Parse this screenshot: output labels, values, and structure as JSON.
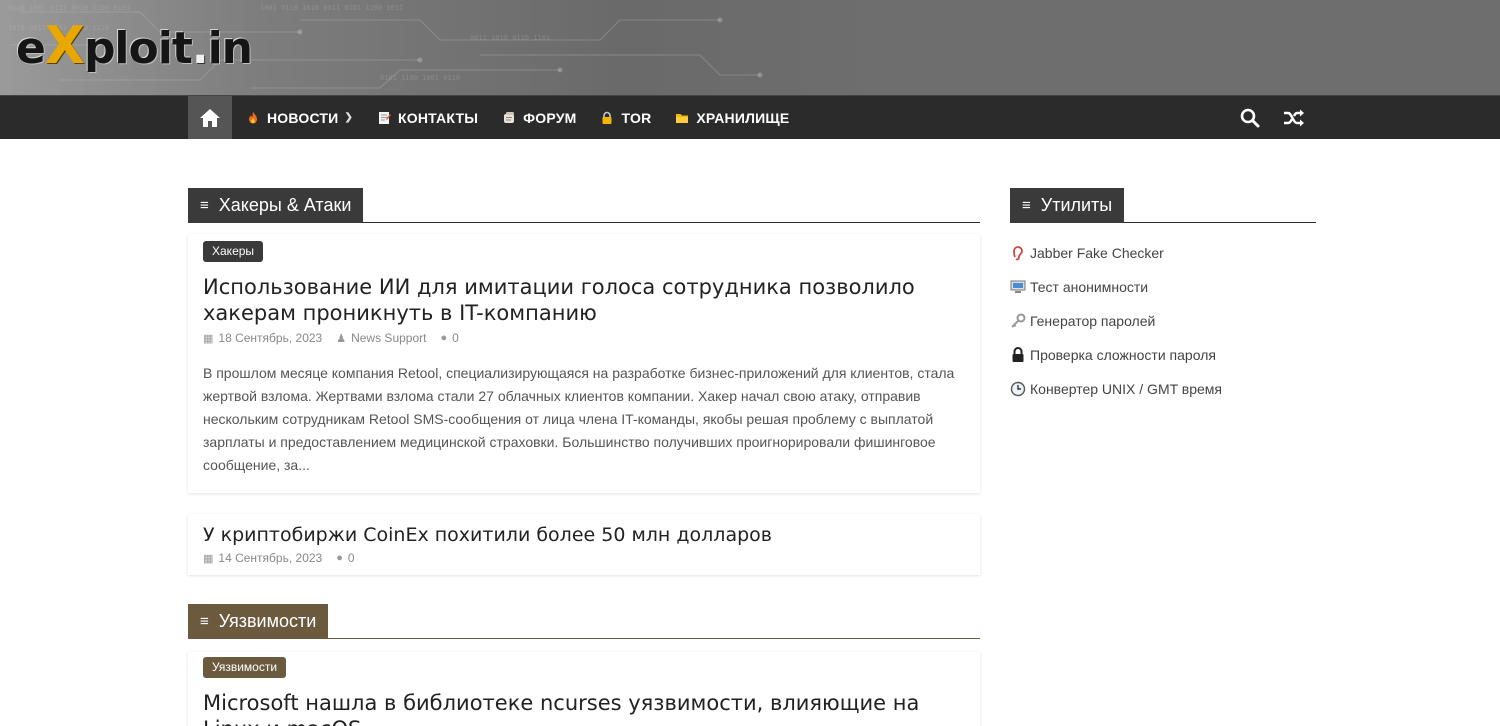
{
  "header": {
    "logo": {
      "part1": "e",
      "x": "X",
      "part2": "ploit",
      "dot": ".",
      "part3": "in"
    }
  },
  "nav": {
    "home_icon": "home-icon",
    "items": [
      {
        "label": "НОВОСТИ",
        "icon": "fire-icon",
        "has_dropdown": true
      },
      {
        "label": "КОНТАКТЫ",
        "icon": "memo-icon",
        "has_dropdown": false
      },
      {
        "label": "ФОРУМ",
        "icon": "scroll-icon",
        "has_dropdown": false
      },
      {
        "label": "TOR",
        "icon": "lock-icon",
        "has_dropdown": false
      },
      {
        "label": "ХРАНИЛИЩЕ",
        "icon": "folder-icon",
        "has_dropdown": false
      }
    ],
    "search_icon": "search-icon",
    "random_icon": "shuffle-icon"
  },
  "sections": {
    "hackers": {
      "title": "Хакеры & Атаки"
    },
    "utilities": {
      "title": "Утилиты"
    },
    "vulns": {
      "title": "Уязвимости"
    }
  },
  "posts": {
    "featured": {
      "category": "Хакеры",
      "title": "Использование ИИ для имитации голоса сотрудника позволило хакерам проникнуть в IT-компанию",
      "date": "18 Сентябрь, 2023",
      "author": "News Support",
      "comments": "0",
      "excerpt": "В прошлом месяце компания Retool, специализирующаяся на разработке бизнес-приложений для клиентов, стала жертвой взлома. Жертвами взлома стали 27 облачных клиентов компании. Хакер начал свою атаку, отправив нескольким сотрудникам Retool SMS-сообщения от лица члена IT-команды, якобы решая проблему с выплатой зарплаты и предоставлением медицинской страховки. Большинство получивших проигнорировали фишинговое сообщение, за..."
    },
    "second": {
      "title": "У криптобиржи CoinEx похитили более 50 млн долларов",
      "date": "14 Сентябрь, 2023",
      "comments": "0"
    },
    "vuln": {
      "category": "Уязвимости",
      "title": "Microsoft нашла в библиотеке ncurses уязвимости, влияющие на Linux и macOS"
    }
  },
  "utilities": [
    {
      "label": "Jabber Fake Checker",
      "icon": "ear-icon"
    },
    {
      "label": "Тест анонимности",
      "icon": "computer-icon"
    },
    {
      "label": "Генератор паролей",
      "icon": "key-icon"
    },
    {
      "label": "Проверка сложности пароля",
      "icon": "lock-icon"
    },
    {
      "label": "Конвертер UNIX / GMT время",
      "icon": "clock-icon"
    }
  ],
  "colors": {
    "nav_bg": "#2b2b2b",
    "section_dark": "#3a3a3a",
    "section_vuln": "#6b5a3e",
    "logo_accent": "#e8a800"
  }
}
